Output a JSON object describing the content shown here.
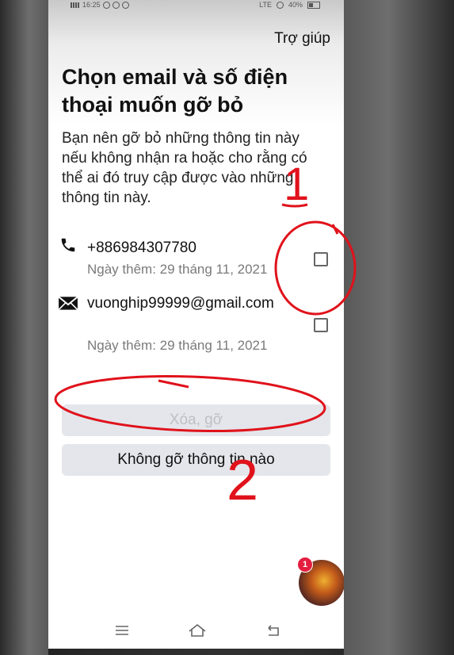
{
  "status_bar": {
    "time": "16:25",
    "battery": "40%",
    "network": "LTE"
  },
  "header": {
    "help_label": "Trợ giúp"
  },
  "main": {
    "title": "Chọn email và số điện thoại muốn gỡ bỏ",
    "description": "Bạn nên gỡ bỏ những thông tin này nếu không nhận ra hoặc cho rằng có thể ai đó truy cập được vào những thông tin này.",
    "contacts": [
      {
        "icon": "phone-icon",
        "value": "+886984307780",
        "date": "Ngày thêm: 29 tháng 11, 2021",
        "checked": false
      },
      {
        "icon": "mail-icon",
        "value": "vuonghip99999@gmail.com",
        "date": "Ngày thêm: 29 tháng 11, 2021",
        "checked": false
      }
    ],
    "remove_button": "Xóa, gỡ",
    "keep_button": "Không gỡ thông tin nào"
  },
  "chat_head": {
    "badge_count": "1"
  },
  "annotations": {
    "mark_1": "1",
    "mark_2": "2",
    "color": "#e0121b"
  },
  "colors": {
    "button_bg": "#e4e6eb",
    "disabled_text": "#bcc0c4",
    "badge": "#e41e3f"
  }
}
